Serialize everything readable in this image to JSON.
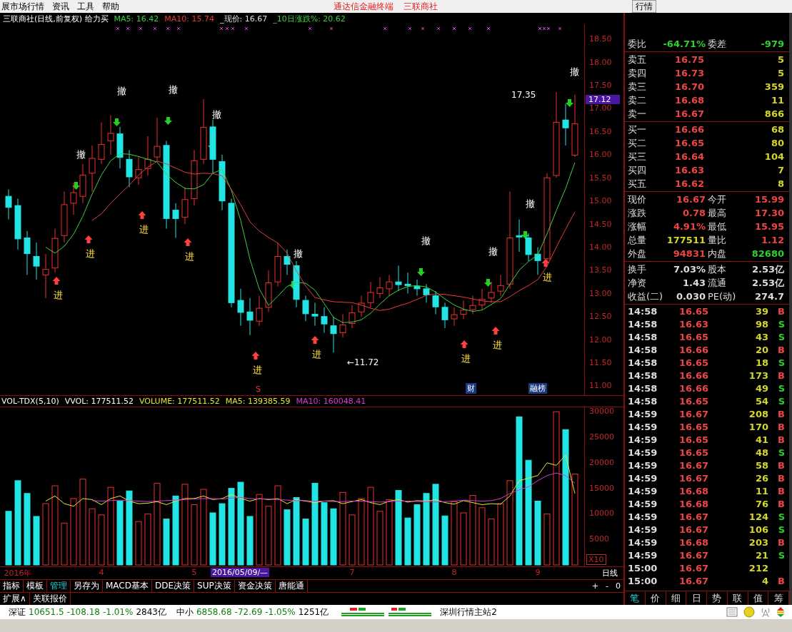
{
  "menu_bar": {
    "items": [
      "展市场行情",
      "资讯",
      "工具",
      "帮助"
    ],
    "links": [
      "通达信金融终端",
      "三联商社"
    ],
    "right_tab": "行情"
  },
  "chart": {
    "title": "三联商社(日线,前复权) 给力买",
    "indicators": [
      {
        "text": "MA5: 16.42",
        "color": "#3fd13f"
      },
      {
        "text": "MA10: 15.74",
        "color": "#e83c3c"
      },
      {
        "text": "_现价: 16.67",
        "color": "#e0e0e0"
      },
      {
        "text": "_10日涨跌%: 20.62",
        "color": "#3fd13f"
      }
    ],
    "chart_data": {
      "type": "candlestick",
      "ylim": [
        10.8,
        18.82
      ],
      "ohlc": [
        [
          15.1,
          15.25,
          14.6,
          14.86
        ],
        [
          14.9,
          15.05,
          13.95,
          14.18
        ],
        [
          14.2,
          14.35,
          13.4,
          13.86
        ],
        [
          13.8,
          14.1,
          13.3,
          13.59
        ],
        [
          13.4,
          13.85,
          12.9,
          13.52
        ],
        [
          13.55,
          14.4,
          13.45,
          14.19
        ],
        [
          14.25,
          15.2,
          14.1,
          14.92
        ],
        [
          14.95,
          15.4,
          14.7,
          15.18
        ],
        [
          15.1,
          15.8,
          14.95,
          15.56
        ],
        [
          15.6,
          16.2,
          15.2,
          15.92
        ],
        [
          15.9,
          16.7,
          15.8,
          16.22
        ],
        [
          16.3,
          16.85,
          16.0,
          16.46
        ],
        [
          16.45,
          16.6,
          15.7,
          15.94
        ],
        [
          15.9,
          16.1,
          15.3,
          15.52
        ],
        [
          15.5,
          15.95,
          15.35,
          15.68
        ],
        [
          15.7,
          16.4,
          15.55,
          15.9
        ],
        [
          15.95,
          16.8,
          15.85,
          16.18
        ],
        [
          16.2,
          16.3,
          14.4,
          14.62
        ],
        [
          14.8,
          14.95,
          14.2,
          14.62
        ],
        [
          14.65,
          15.3,
          14.5,
          15.03
        ],
        [
          15.05,
          16.1,
          14.9,
          15.87
        ],
        [
          15.9,
          17.2,
          15.8,
          16.59
        ],
        [
          16.6,
          16.75,
          15.6,
          15.9
        ],
        [
          15.85,
          16.0,
          14.8,
          15.0
        ],
        [
          14.95,
          15.05,
          12.7,
          12.8
        ],
        [
          12.85,
          13.1,
          12.3,
          12.59
        ],
        [
          12.6,
          12.9,
          12.1,
          12.42
        ],
        [
          12.4,
          12.95,
          12.3,
          12.68
        ],
        [
          12.7,
          13.5,
          12.6,
          13.23
        ],
        [
          13.25,
          14.1,
          13.15,
          13.8
        ],
        [
          13.8,
          13.95,
          13.4,
          13.63
        ],
        [
          13.6,
          13.7,
          12.7,
          12.87
        ],
        [
          12.85,
          12.95,
          12.4,
          12.56
        ],
        [
          12.55,
          12.8,
          12.3,
          12.51
        ],
        [
          12.5,
          12.7,
          12.15,
          12.34
        ],
        [
          12.3,
          12.5,
          11.72,
          12.13
        ],
        [
          12.15,
          12.55,
          12.05,
          12.32
        ],
        [
          12.35,
          12.75,
          12.25,
          12.58
        ],
        [
          12.6,
          12.95,
          12.5,
          12.79
        ],
        [
          12.8,
          13.25,
          12.7,
          13.02
        ],
        [
          13.0,
          13.35,
          12.9,
          13.12
        ],
        [
          13.1,
          13.4,
          12.95,
          13.25
        ],
        [
          13.25,
          13.6,
          13.05,
          13.19
        ],
        [
          13.2,
          13.45,
          13.0,
          13.17
        ],
        [
          13.15,
          13.3,
          12.95,
          13.1
        ],
        [
          13.1,
          13.2,
          12.8,
          12.97
        ],
        [
          12.95,
          13.05,
          12.55,
          12.71
        ],
        [
          12.7,
          12.8,
          12.25,
          12.43
        ],
        [
          12.45,
          12.7,
          12.3,
          12.54
        ],
        [
          12.55,
          12.85,
          12.45,
          12.64
        ],
        [
          12.65,
          12.95,
          12.55,
          12.74
        ],
        [
          12.75,
          13.1,
          12.65,
          12.87
        ],
        [
          12.9,
          13.25,
          12.8,
          13.02
        ],
        [
          13.05,
          13.4,
          12.95,
          13.17
        ],
        [
          13.2,
          15.2,
          13.1,
          14.2
        ],
        [
          14.25,
          14.6,
          13.9,
          14.22
        ],
        [
          14.2,
          14.3,
          13.7,
          13.84
        ],
        [
          13.85,
          14.0,
          13.4,
          13.71
        ],
        [
          13.75,
          15.6,
          13.7,
          15.5
        ],
        [
          15.55,
          17.35,
          15.5,
          16.7
        ],
        [
          16.75,
          17.1,
          16.2,
          16.58
        ],
        [
          15.99,
          17.3,
          15.95,
          16.67
        ]
      ],
      "yticks": [
        {
          "value": 18.5,
          "label": "18.50"
        },
        {
          "value": 18,
          "label": "18.00"
        },
        {
          "value": 17.5,
          "label": "17.50"
        },
        {
          "value": 17,
          "label": "17.00"
        },
        {
          "value": 16.5,
          "label": "16.50"
        },
        {
          "value": 16,
          "label": "16.00"
        },
        {
          "value": 15.5,
          "label": "15.50"
        },
        {
          "value": 15,
          "label": "15.00"
        },
        {
          "value": 14.5,
          "label": "14.50"
        },
        {
          "value": 14,
          "label": "14.00"
        },
        {
          "value": 13.5,
          "label": "13.50"
        },
        {
          "value": 13,
          "label": "13.00"
        },
        {
          "value": 12.5,
          "label": "12.50"
        },
        {
          "value": 12,
          "label": "12.00"
        },
        {
          "value": 11.5,
          "label": "11.50"
        },
        {
          "value": 11,
          "label": "11.00"
        }
      ],
      "series": [
        {
          "type": "line",
          "color": "#3fd13f",
          "values": [
            null,
            null,
            null,
            null,
            14.0,
            13.87,
            14.02,
            14.28,
            14.67,
            15.15,
            15.56,
            15.87,
            16.02,
            16.01,
            15.96,
            15.9,
            15.84,
            15.58,
            15.4,
            15.27,
            15.26,
            15.35,
            15.6,
            15.68,
            15.23,
            14.58,
            13.74,
            13.1,
            12.74,
            12.94,
            13.15,
            13.24,
            13.22,
            13.07,
            12.78,
            12.48,
            12.37,
            12.38,
            12.43,
            12.57,
            12.77,
            12.95,
            13.07,
            13.15,
            13.17,
            13.14,
            13.03,
            12.88,
            12.75,
            12.66,
            12.61,
            12.64,
            12.76,
            12.89,
            13.2,
            13.5,
            13.69,
            13.83,
            14.29,
            14.79,
            15.27,
            15.83
          ]
        },
        {
          "type": "line",
          "color": "#e83c3c",
          "values": [
            null,
            null,
            null,
            null,
            null,
            null,
            null,
            null,
            null,
            14.58,
            14.72,
            14.95,
            15.15,
            15.34,
            15.56,
            15.73,
            15.86,
            15.8,
            15.71,
            15.62,
            15.58,
            15.6,
            15.59,
            15.54,
            15.25,
            14.92,
            14.55,
            14.35,
            14.21,
            14.09,
            13.87,
            13.49,
            13.16,
            12.91,
            12.86,
            12.82,
            12.81,
            12.8,
            12.75,
            12.68,
            12.63,
            12.66,
            12.73,
            12.79,
            12.87,
            12.96,
            12.99,
            12.98,
            12.95,
            12.92,
            12.88,
            12.84,
            12.82,
            12.82,
            12.93,
            13.06,
            13.17,
            13.3,
            13.59,
            14.0,
            14.39,
            14.76
          ]
        }
      ]
    },
    "price_tag": "17.12",
    "signals": [
      {
        "kind": "sell",
        "text": "撤"
      },
      {
        "kind": "sell",
        "text": "撤"
      },
      {
        "kind": "sell",
        "text": "撤"
      },
      {
        "kind": "sell",
        "text": "撤"
      },
      {
        "kind": "sell",
        "text": "撤"
      },
      {
        "kind": "sell",
        "text": "撤"
      },
      {
        "kind": "sell",
        "text": "撤"
      },
      {
        "kind": "sell",
        "text": "撤"
      },
      {
        "kind": "sell",
        "text": "撤"
      },
      {
        "kind": "buy",
        "text": "进"
      },
      {
        "kind": "buy",
        "text": "进"
      },
      {
        "kind": "buy",
        "text": "进"
      },
      {
        "kind": "buy",
        "text": "进"
      },
      {
        "kind": "buy",
        "text": "进"
      },
      {
        "kind": "buy",
        "text": "进"
      },
      {
        "kind": "buy",
        "text": "进"
      },
      {
        "kind": "buy",
        "text": "进"
      },
      {
        "kind": "buy",
        "text": "进"
      }
    ],
    "labels": [
      {
        "kind": "high",
        "text": "17.35"
      },
      {
        "kind": "low",
        "text": "←11.72"
      }
    ],
    "events": [
      {
        "kind": "plain",
        "text": "S"
      },
      {
        "kind": "boxed",
        "text": "财"
      },
      {
        "kind": "boxed",
        "text": "融榜"
      }
    ]
  },
  "volume": {
    "indicators": [
      {
        "text": "VOL-TDX(5,10)",
        "color": "#ffffff"
      },
      {
        "text": "VVOL: 177511.52",
        "color": "#ffffff"
      },
      {
        "text": "VOLUME: 177511.52",
        "color": "#e6e62e"
      },
      {
        "text": "MA5: 139385.59",
        "color": "#e6e62e"
      },
      {
        "text": "MA10: 160048.41",
        "color": "#d43cd4"
      }
    ],
    "chart_data": {
      "type": "bar",
      "ylim": [
        0,
        30866
      ],
      "categories": [
        null,
        "2016年",
        null,
        null,
        null,
        null,
        null,
        null,
        null,
        null,
        "4",
        null,
        null,
        null,
        null,
        null,
        null,
        null,
        null,
        null,
        "5",
        null,
        null,
        null,
        null,
        null,
        null,
        null,
        null,
        null,
        null,
        null,
        null,
        null,
        null,
        null,
        null,
        "7",
        null,
        null,
        null,
        null,
        null,
        null,
        null,
        null,
        null,
        null,
        "8",
        null,
        null,
        null,
        null,
        null,
        null,
        null,
        null,
        "9",
        null,
        null,
        null,
        null
      ],
      "yticks": [
        {
          "value": 30000,
          "label": "30000"
        },
        {
          "value": 25000,
          "label": "25000"
        },
        {
          "value": 20000,
          "label": "20000"
        },
        {
          "value": 15000,
          "label": "15000"
        },
        {
          "value": 10000,
          "label": "10000"
        },
        {
          "value": 5000,
          "label": "5000"
        }
      ],
      "series": [
        {
          "type": "bar",
          "colors": [
            "#22e4e4",
            "#22e4e4",
            "#22e4e4",
            "#22e4e4",
            "#ee3030",
            "#ee3030",
            "#ee3030",
            "#ee3030",
            "#ee3030",
            "#ee3030",
            "#ee3030",
            "#ee3030",
            "#22e4e4",
            "#22e4e4",
            "#ee3030",
            "#ee3030",
            "#ee3030",
            "#22e4e4",
            "#22e4e4",
            "#ee3030",
            "#ee3030",
            "#ee3030",
            "#22e4e4",
            "#22e4e4",
            "#22e4e4",
            "#22e4e4",
            "#22e4e4",
            "#ee3030",
            "#ee3030",
            "#ee3030",
            "#22e4e4",
            "#22e4e4",
            "#22e4e4",
            "#22e4e4",
            "#22e4e4",
            "#22e4e4",
            "#ee3030",
            "#ee3030",
            "#ee3030",
            "#ee3030",
            "#ee3030",
            "#ee3030",
            "#22e4e4",
            "#22e4e4",
            "#22e4e4",
            "#22e4e4",
            "#22e4e4",
            "#22e4e4",
            "#ee3030",
            "#ee3030",
            "#ee3030",
            "#ee3030",
            "#ee3030",
            "#ee3030",
            "#ee3030",
            "#22e4e4",
            "#22e4e4",
            "#22e4e4",
            "#ee3030",
            "#ee3030",
            "#22e4e4",
            "#ee3030"
          ],
          "values": [
            10500,
            16500,
            14000,
            9500,
            12000,
            15500,
            8200,
            13000,
            16800,
            11000,
            9800,
            15200,
            12500,
            14500,
            8500,
            10000,
            16000,
            9000,
            13500,
            15800,
            11800,
            14800,
            10200,
            12000,
            15000,
            16200,
            9500,
            13800,
            11500,
            15500,
            10800,
            13200,
            9000,
            16000,
            12200,
            11000,
            14200,
            9800,
            13000,
            15200,
            10500,
            12800,
            14600,
            9200,
            11800,
            14000,
            15800,
            9600,
            12400,
            10200,
            13600,
            11200,
            9000,
            12000,
            16500,
            29000,
            20500,
            12500,
            10000,
            30000,
            26500,
            17800
          ]
        },
        {
          "type": "line",
          "color": "#e6e62e",
          "values": [
            null,
            null,
            null,
            null,
            12500,
            13500,
            12000,
            11500,
            13000,
            12800,
            11800,
            13000,
            13500,
            12500,
            12000,
            12100,
            12400,
            11800,
            12500,
            13000,
            13000,
            13500,
            12800,
            13000,
            13800,
            13000,
            12500,
            13000,
            12800,
            13000,
            12000,
            12800,
            12500,
            12200,
            12500,
            12600,
            12000,
            12400,
            12800,
            12200,
            11800,
            12500,
            12800,
            12300,
            12600,
            12500,
            12800,
            12200,
            11900,
            12600,
            12200,
            11800,
            12000,
            11900,
            13500,
            16500,
            17000,
            17500,
            20000,
            19500,
            21500,
            14000
          ]
        },
        {
          "type": "line",
          "color": "#d43cd4",
          "values": [
            null,
            null,
            null,
            null,
            null,
            null,
            null,
            null,
            null,
            12600,
            12500,
            12600,
            12700,
            12600,
            12500,
            12400,
            12500,
            12600,
            12700,
            12800,
            12900,
            13000,
            13000,
            12900,
            13100,
            13200,
            13000,
            12900,
            12900,
            12800,
            12700,
            12600,
            12600,
            12500,
            12500,
            12400,
            12400,
            12500,
            12500,
            12400,
            12300,
            12400,
            12500,
            12500,
            12400,
            12400,
            12300,
            12400,
            12500,
            12700,
            12600,
            12500,
            12600,
            13000,
            14000,
            14700,
            15300,
            16500,
            17500,
            18000,
            17500,
            16000
          ]
        }
      ]
    },
    "scale": "X10"
  },
  "date_axis": {
    "cursor": "2016/05/09/—",
    "period": "日线"
  },
  "toolbar": {
    "tabs": [
      {
        "label": "指标",
        "selected": false
      },
      {
        "label": "模板",
        "selected": false
      },
      {
        "label": "管理",
        "selected": true
      },
      {
        "label": "另存为",
        "selected": false
      },
      {
        "label": "MACD基本",
        "selected": false
      },
      {
        "label": "DDE决策",
        "selected": false
      },
      {
        "label": "SUP决策",
        "selected": false
      },
      {
        "label": "资金决策",
        "selected": false
      },
      {
        "label": "唐能通",
        "selected": false
      }
    ],
    "zoom_buttons": [
      "+",
      "-",
      "0"
    ],
    "row2": [
      "扩展∧",
      "关联报价"
    ]
  },
  "quote": {
    "ratio": [
      {
        "label": "委比",
        "value": "-64.71%"
      },
      {
        "label": "委差",
        "value": "-979"
      }
    ],
    "asks": [
      {
        "label": "卖五",
        "price": "16.75",
        "volume": "5"
      },
      {
        "label": "卖四",
        "price": "16.73",
        "volume": "5"
      },
      {
        "label": "卖三",
        "price": "16.70",
        "volume": "359"
      },
      {
        "label": "卖二",
        "price": "16.68",
        "volume": "11"
      },
      {
        "label": "卖一",
        "price": "16.67",
        "volume": "866"
      }
    ],
    "bids": [
      {
        "label": "买一",
        "price": "16.66",
        "volume": "68"
      },
      {
        "label": "买二",
        "price": "16.65",
        "volume": "80"
      },
      {
        "label": "买三",
        "price": "16.64",
        "volume": "104"
      },
      {
        "label": "买四",
        "price": "16.63",
        "volume": "7"
      },
      {
        "label": "买五",
        "price": "16.62",
        "volume": "8"
      }
    ],
    "stats": [
      {
        "label": "现价",
        "value": "16.67",
        "color": "#ee4444"
      },
      {
        "label": "今开",
        "value": "15.99",
        "color": "#ee4444"
      },
      {
        "label": "涨跌",
        "value": "0.78",
        "color": "#ee4444"
      },
      {
        "label": "最高",
        "value": "17.30",
        "color": "#ee4444"
      },
      {
        "label": "涨幅",
        "value": "4.91%",
        "color": "#ee4444"
      },
      {
        "label": "最低",
        "value": "15.95",
        "color": "#ee4444"
      },
      {
        "label": "总量",
        "value": "177511",
        "color": "#d6d62a"
      },
      {
        "label": "量比",
        "value": "1.12",
        "color": "#ee4444"
      },
      {
        "label": "外盘",
        "value": "94831",
        "color": "#ee4444"
      },
      {
        "label": "内盘",
        "value": "82680",
        "color": "#2fcf2f"
      }
    ],
    "fundamentals": [
      {
        "label": "换手",
        "value": "7.03%"
      },
      {
        "label": "股本",
        "value": "2.53亿"
      },
      {
        "label": "净资",
        "value": "1.43"
      },
      {
        "label": "流通",
        "value": "2.53亿"
      },
      {
        "label": "收益(二)",
        "value": "0.030"
      },
      {
        "label": "PE(动)",
        "value": "274.7"
      }
    ]
  },
  "trades": [
    {
      "time": "14:58",
      "price": "16.65",
      "volume": "39",
      "kind": "buy",
      "side": "B"
    },
    {
      "time": "14:58",
      "price": "16.63",
      "volume": "98",
      "kind": "sell",
      "side": "S"
    },
    {
      "time": "14:58",
      "price": "16.65",
      "volume": "43",
      "kind": "sell",
      "side": "S"
    },
    {
      "time": "14:58",
      "price": "16.66",
      "volume": "20",
      "kind": "buy",
      "side": "B"
    },
    {
      "time": "14:58",
      "price": "16.65",
      "volume": "18",
      "kind": "sell",
      "side": "S"
    },
    {
      "time": "14:58",
      "price": "16.66",
      "volume": "173",
      "kind": "buy",
      "side": "B"
    },
    {
      "time": "14:58",
      "price": "16.66",
      "volume": "49",
      "kind": "sell",
      "side": "S"
    },
    {
      "time": "14:58",
      "price": "16.65",
      "volume": "54",
      "kind": "sell",
      "side": "S"
    },
    {
      "time": "14:59",
      "price": "16.67",
      "volume": "208",
      "kind": "buy",
      "side": "B"
    },
    {
      "time": "14:59",
      "price": "16.65",
      "volume": "170",
      "kind": "buy",
      "side": "B"
    },
    {
      "time": "14:59",
      "price": "16.65",
      "volume": "41",
      "kind": "buy",
      "side": "B"
    },
    {
      "time": "14:59",
      "price": "16.65",
      "volume": "48",
      "kind": "sell",
      "side": "S"
    },
    {
      "time": "14:59",
      "price": "16.67",
      "volume": "58",
      "kind": "buy",
      "side": "B"
    },
    {
      "time": "14:59",
      "price": "16.67",
      "volume": "26",
      "kind": "buy",
      "side": "B"
    },
    {
      "time": "14:59",
      "price": "16.68",
      "volume": "11",
      "kind": "buy",
      "side": "B"
    },
    {
      "time": "14:59",
      "price": "16.68",
      "volume": "76",
      "kind": "buy",
      "side": "B"
    },
    {
      "time": "14:59",
      "price": "16.67",
      "volume": "124",
      "kind": "sell",
      "side": "S"
    },
    {
      "time": "14:59",
      "price": "16.67",
      "volume": "106",
      "kind": "sell",
      "side": "S"
    },
    {
      "time": "14:59",
      "price": "16.68",
      "volume": "203",
      "kind": "buy",
      "side": "B"
    },
    {
      "time": "14:59",
      "price": "16.67",
      "volume": "21",
      "kind": "sell",
      "side": "S"
    },
    {
      "time": "15:00",
      "price": "16.67",
      "volume": "212",
      "kind": "none"
    },
    {
      "time": "15:00",
      "price": "16.67",
      "volume": "4",
      "kind": "buy",
      "side": "B"
    }
  ],
  "panel_tabs": [
    {
      "label": "笔",
      "selected": true
    },
    {
      "label": "价",
      "selected": false
    },
    {
      "label": "细",
      "selected": false
    },
    {
      "label": "日",
      "selected": false
    },
    {
      "label": "势",
      "selected": false
    },
    {
      "label": "联",
      "selected": false
    },
    {
      "label": "值",
      "selected": false
    },
    {
      "label": "筹",
      "selected": false
    }
  ],
  "status_bar": {
    "indices": [
      {
        "name": "深证",
        "value": "10651.5",
        "change": "-108.18",
        "percent": "-1.01%",
        "amount": "2843亿"
      },
      {
        "name": "中小",
        "value": "6858.68",
        "change": "-72.69",
        "percent": "-1.05%",
        "amount": "1251亿"
      }
    ],
    "server": "深圳行情主站2"
  }
}
